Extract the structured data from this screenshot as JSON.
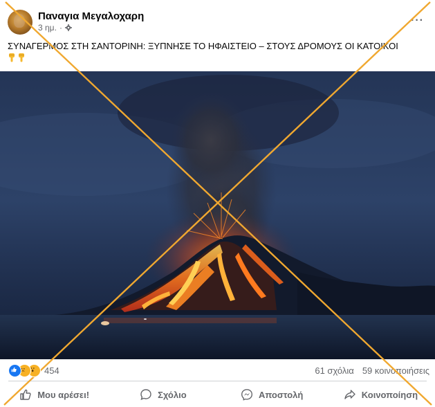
{
  "post": {
    "author": "Παναγια Μεγαλοχαρη",
    "time": "3 ημ.",
    "separator": "·",
    "caption": "ΣΥΝΑΓΕΡΜΟΣ ΣΤΗ ΣΑΝΤΟΡΙΝΗ: ΞΥΠΝΗΣΕ ΤΟ ΗΦΑΙΣΤΕΙΟ – ΣΤΟΥΣ ΔΡΟΜΟΥΣ ΟΙ ΚΑΤΟΙΚΟΙ",
    "emoji": [
      "👇",
      "👇"
    ],
    "more_label": "···",
    "image_icon": "erupting-volcano-photo"
  },
  "stats": {
    "reactions_count": "454",
    "reaction_icons": [
      "like-icon",
      "sad-icon",
      "wow-icon"
    ],
    "comments": "61 σχόλια",
    "shares": "59 κοινοποιήσεις"
  },
  "actions": {
    "like": "Μου αρέσει!",
    "comment": "Σχόλιο",
    "send": "Αποστολή",
    "share": "Κοινοποίηση"
  },
  "colors": {
    "cross": "#f0a830",
    "like_blue": "#1877f2",
    "text_secondary": "#65676b",
    "sky_dark": "#1b2a48",
    "lava": "#ff6a1a"
  }
}
